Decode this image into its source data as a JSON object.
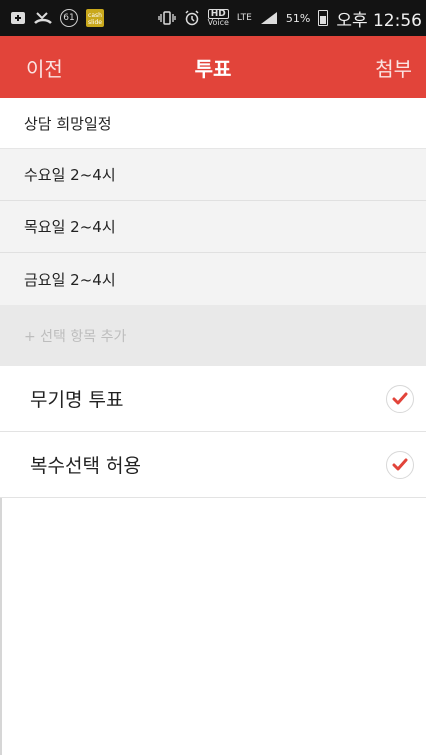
{
  "status_bar": {
    "icons_left": [
      "add-box-icon",
      "missed-call-icon",
      "badge-61-icon",
      "cash-slide-icon"
    ],
    "badge_number": "61",
    "cash_label": "cash slide",
    "icons_right": [
      "vibrate-icon",
      "alarm-icon",
      "hd-voice-icon",
      "lte-icon",
      "signal-icon",
      "battery-icon"
    ],
    "hd_label": "HD",
    "voice_label": "Voice",
    "lte_label": "LTE",
    "battery": "51%",
    "time": "오후 12:56"
  },
  "app_bar": {
    "back_label": "이전",
    "title": "투표",
    "attach_label": "첨부",
    "color": "#e2443a"
  },
  "vote": {
    "title": "상담 희망일정",
    "options": [
      {
        "label": "수요일 2~4시"
      },
      {
        "label": "목요일 2~4시"
      },
      {
        "label": "금요일 2~4시"
      }
    ],
    "add_option_placeholder": "+ 선택 항목 추가"
  },
  "settings": [
    {
      "label": "무기명 투표",
      "checked": true
    },
    {
      "label": "복수선택 허용",
      "checked": true
    }
  ],
  "accent": "#e2443a"
}
